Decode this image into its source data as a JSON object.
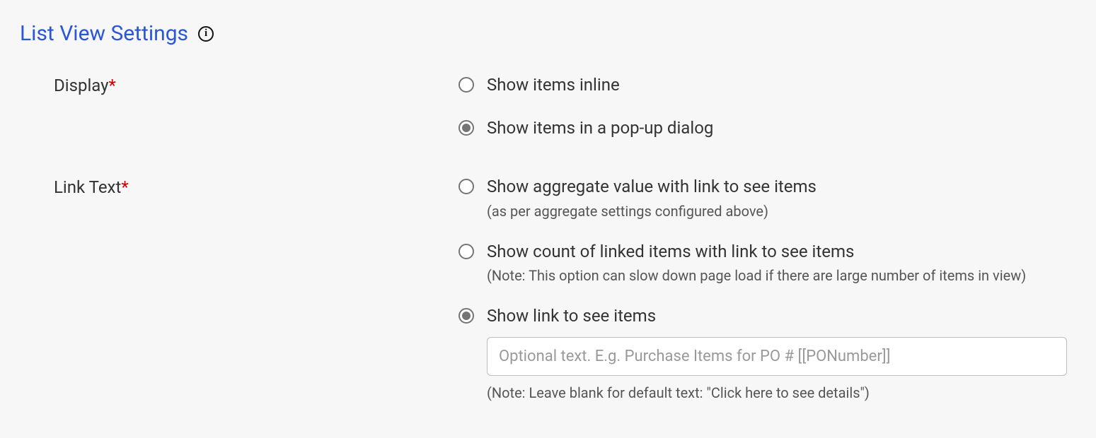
{
  "section": {
    "title": "List View Settings"
  },
  "fields": {
    "display": {
      "label": "Display",
      "options": {
        "inline": "Show items inline",
        "popup": "Show items in a pop-up dialog"
      }
    },
    "linkText": {
      "label": "Link Text",
      "options": {
        "aggregate": {
          "label": "Show aggregate value with link to see items",
          "hint": "(as per aggregate settings configured above)"
        },
        "count": {
          "label": "Show count of linked items with link to see items",
          "hint": "(Note: This option can slow down page load if there are large number of items in view)"
        },
        "link": {
          "label": "Show link to see items"
        }
      },
      "input": {
        "placeholder": "Optional text. E.g. Purchase Items for PO # [[PONumber]]",
        "value": "",
        "hint": "(Note: Leave blank for default text: \"Click here to see details\")"
      }
    }
  }
}
